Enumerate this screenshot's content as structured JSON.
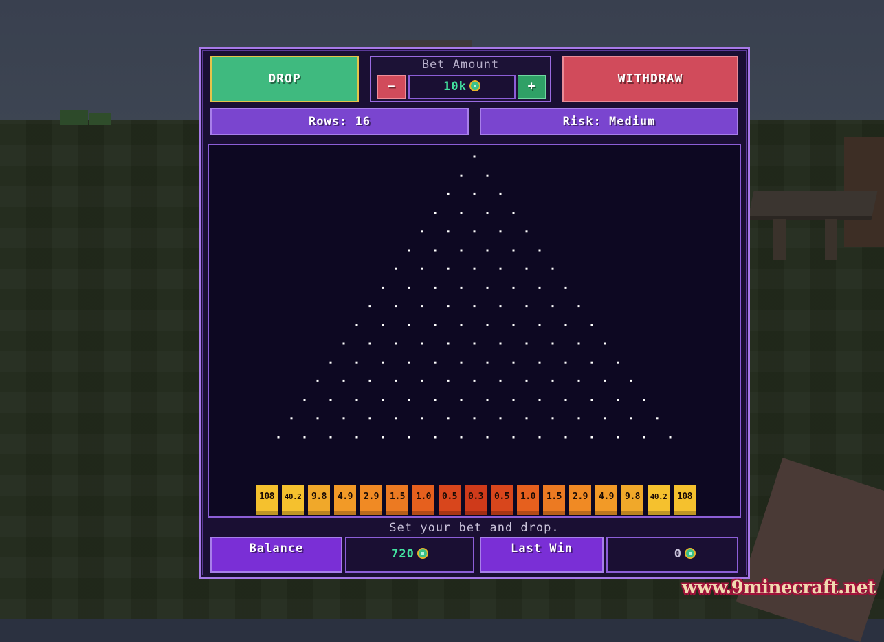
{
  "controls": {
    "drop_label": "DROP",
    "withdraw_label": "WITHDRAW",
    "bet_label": "Bet Amount",
    "bet_minus": "−",
    "bet_plus": "+",
    "bet_value": "10k",
    "rows_label": "Rows: 16",
    "risk_label": "Risk: Medium"
  },
  "board": {
    "peg_rows": 16,
    "peg_color": "#ffffff",
    "multipliers": [
      "108",
      "40.2",
      "9.8",
      "4.9",
      "2.9",
      "1.5",
      "1.0",
      "0.5",
      "0.3",
      "0.5",
      "1.0",
      "1.5",
      "2.9",
      "4.9",
      "9.8",
      "40.2",
      "108"
    ],
    "multiplier_colors": [
      "#f5c12e",
      "#f5c12e",
      "#f0a82a",
      "#f29a27",
      "#f08a24",
      "#ec7a22",
      "#e6601e",
      "#d8461c",
      "#cf3a1a",
      "#d8461c",
      "#e6601e",
      "#ec7a22",
      "#f08a24",
      "#f29a27",
      "#f0a82a",
      "#f5c12e",
      "#f5c12e"
    ]
  },
  "status": {
    "message": "Set your bet and drop."
  },
  "stats": {
    "balance_label": "Balance",
    "balance_value": "720",
    "last_win_label": "Last Win",
    "last_win_value": "0"
  },
  "currency_icon": "emerald-coin-icon",
  "watermark": "www.9minecraft.net"
}
